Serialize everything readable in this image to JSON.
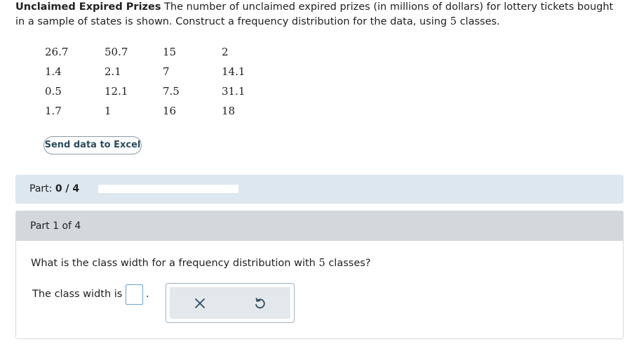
{
  "problem": {
    "title": "Unclaimed Expired Prizes",
    "text_before_num": "The number of unclaimed expired prizes (in millions of dollars) for lottery tickets bought in a sample of states is shown. Construct a frequency distribution for the data, using",
    "num_classes": "5",
    "text_after_num": "classes."
  },
  "data_table": {
    "rows": [
      [
        "26.7",
        "50.7",
        "15",
        "2"
      ],
      [
        "1.4",
        "2.1",
        "7",
        "14.1"
      ],
      [
        "0.5",
        "12.1",
        "7.5",
        "31.1"
      ],
      [
        "1.7",
        "1",
        "16",
        "18"
      ]
    ]
  },
  "excel_button": {
    "label": "Send data to Excel"
  },
  "part_progress": {
    "prefix": "Part:",
    "value": "0 / 4",
    "completed_fraction": 0
  },
  "part": {
    "header": "Part 1 of 4",
    "question_before": "What is the class width for a frequency distribution with",
    "question_num": "5",
    "question_after": "classes?",
    "answer_label": "The class width is",
    "period": "."
  },
  "tools": {
    "clear_icon": "close-icon",
    "undo_icon": "undo-icon",
    "icon_color": "#2d4a5e"
  },
  "colors": {
    "part_bar_bg": "#dce7ef",
    "part_header_bg": "#d2d8dc",
    "answer_box_border": "#6aa5cc"
  }
}
